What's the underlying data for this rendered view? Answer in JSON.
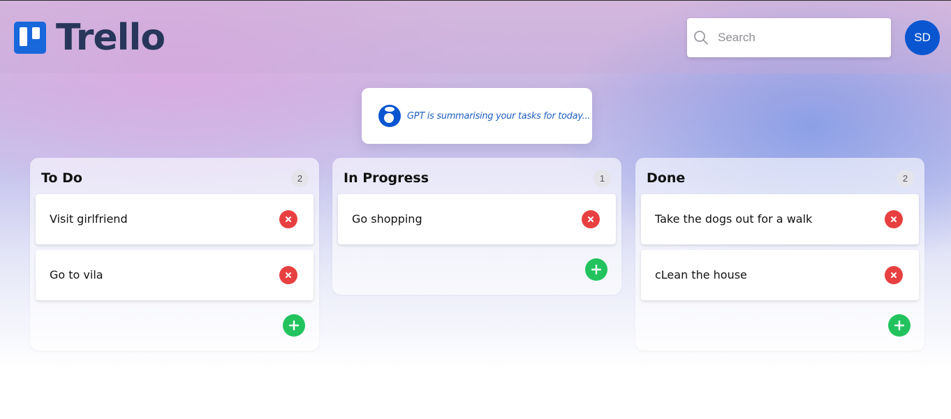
{
  "header": {
    "logo_text": "Trello",
    "search": {
      "placeholder": "Search",
      "value": ""
    },
    "avatar_initials": "SD"
  },
  "gpt_banner": {
    "text": "GPT is summarising your tasks for today..."
  },
  "columns": [
    {
      "title": "To Do",
      "count": "2",
      "cards": [
        {
          "text": "Visit girlfriend"
        },
        {
          "text": "Go to vila"
        }
      ]
    },
    {
      "title": "In Progress",
      "count": "1",
      "cards": [
        {
          "text": "Go shopping"
        }
      ]
    },
    {
      "title": "Done",
      "count": "2",
      "cards": [
        {
          "text": "Take the dogs out for a walk"
        },
        {
          "text": "cLean the house"
        }
      ]
    }
  ],
  "icons": {
    "delete": "x-icon",
    "add": "plus-icon",
    "search": "search-icon",
    "gpt": "gpt-logo-icon"
  },
  "colors": {
    "brand": "#1868db",
    "logo_text": "#27365a",
    "avatar": "#0a56d1",
    "delete": "#e84040",
    "add": "#22c35e",
    "gpt_text": "#1f5fbf"
  }
}
